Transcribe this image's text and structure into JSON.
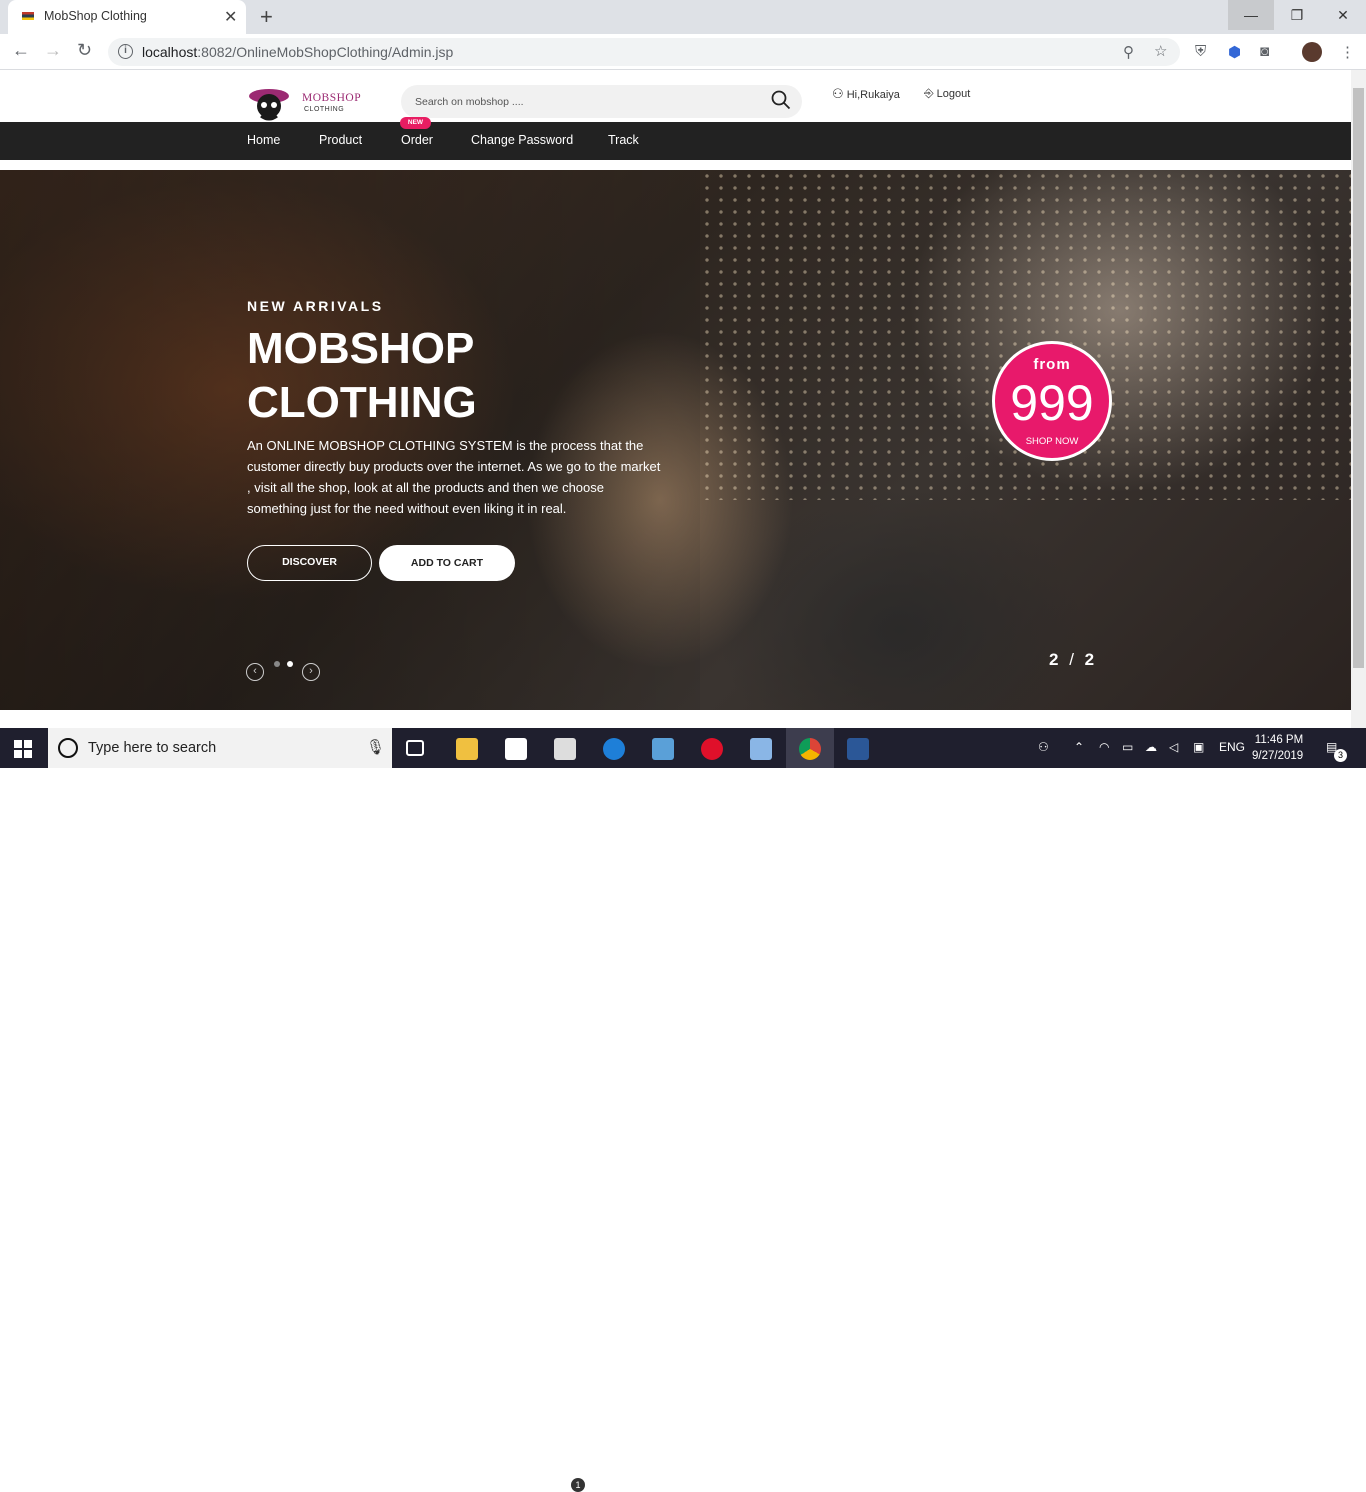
{
  "browser": {
    "tab_title": "MobShop Clothing",
    "tab_close": "✕",
    "new_tab": "+",
    "url_host": "localhost",
    "url_rest": ":8082/OnlineMobShopClothing/Admin.jsp",
    "window_controls": [
      "—",
      "❐",
      "✕"
    ]
  },
  "site": {
    "logo_text": "MOBSHOP",
    "logo_sub": "CLOTHING",
    "search_placeholder": "Search on mobshop ....",
    "user_greeting": "Hi,Rukaiya",
    "logout": "Logout"
  },
  "nav": {
    "items": [
      "Home",
      "Product",
      "Order",
      "Change Password",
      "Track"
    ],
    "badge": "NEW"
  },
  "hero": {
    "tagline": "NEW ARRIVALS",
    "title_line1": "MOBSHOP",
    "title_line2": "CLOTHING",
    "description": "An ONLINE MOBSHOP CLOTHING SYSTEM is the process that the customer directly buy products over the internet. As we go to the market , visit all the shop, look at all the products and then we choose something just for the need without even liking it in real.",
    "discover_label": "DISCOVER",
    "cart_label": "ADD TO CART",
    "promo_from": "from",
    "promo_price": "999",
    "promo_cta": "SHOP NOW",
    "slide_current": "2",
    "slide_total": "2",
    "slide_separator": "/",
    "prev_arrow": "‹",
    "next_arrow": "›"
  },
  "taskbar": {
    "search_text": "Type here to search",
    "language": "ENG",
    "time": "11:46 PM",
    "date": "9/27/2019",
    "notifications": "3",
    "mail_badge": "1"
  },
  "colors": {
    "accent": "#e8196b",
    "nav_bg": "#222222",
    "logo_purple": "#9b2a72"
  }
}
